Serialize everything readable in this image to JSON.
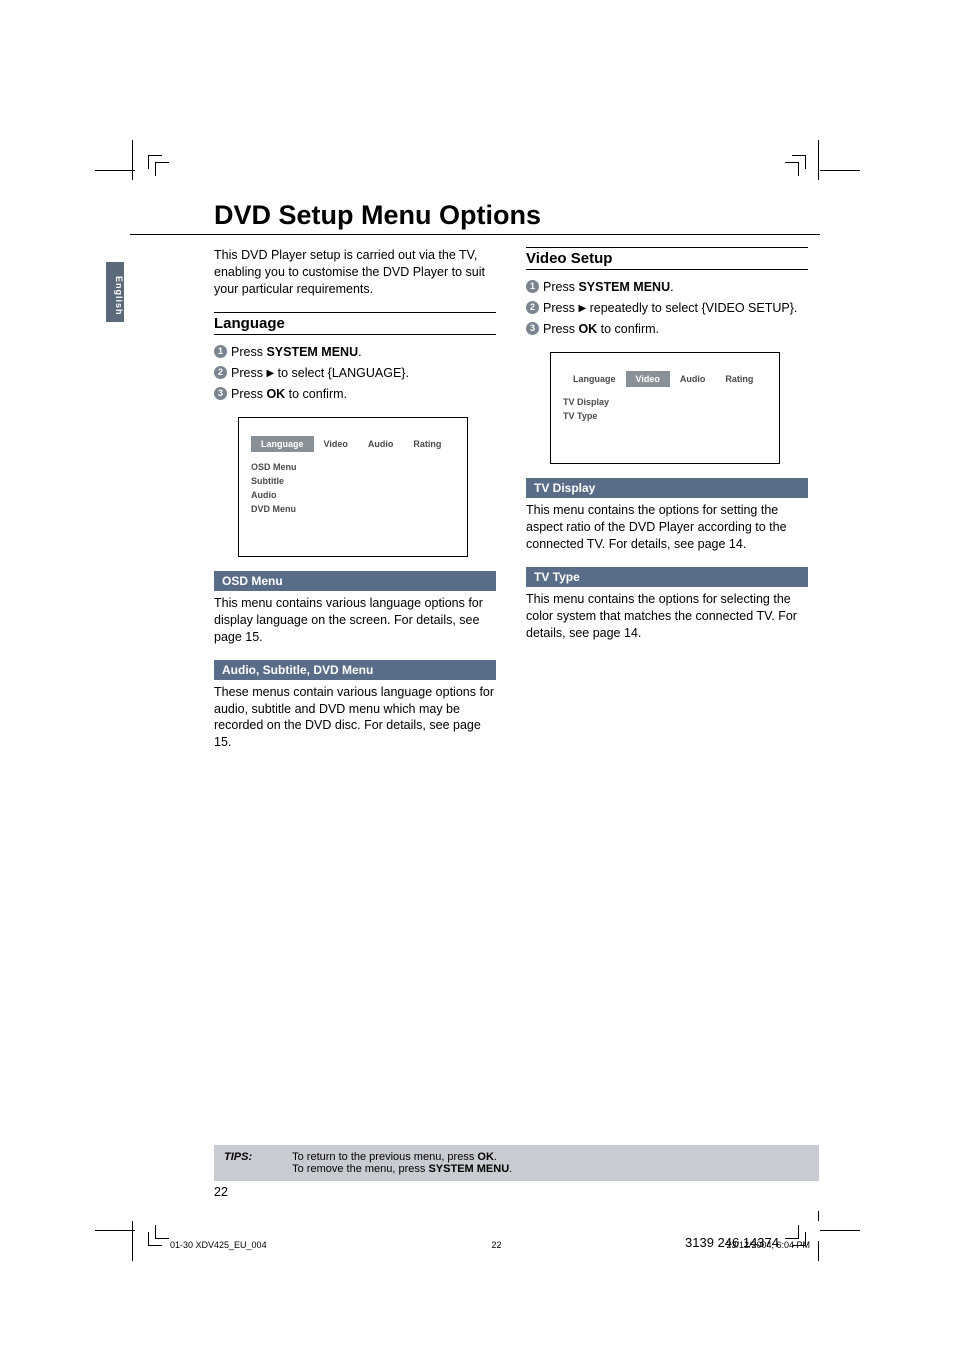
{
  "lang_tab": "English",
  "title": "DVD Setup Menu Options",
  "intro": "This DVD Player setup is carried out via the TV, enabling you to customise the DVD Player to suit your particular requirements.",
  "language": {
    "heading": "Language",
    "steps": [
      {
        "pre": "Press ",
        "bold": "SYSTEM MENU",
        "post": "."
      },
      {
        "pre": "Press ",
        "arrow": "▶",
        "post": " to select {LANGUAGE}."
      },
      {
        "pre": "Press ",
        "bold": "OK",
        "post": " to confirm."
      }
    ],
    "screen": {
      "tabs": [
        "Language",
        "Video",
        "Audio",
        "Rating"
      ],
      "active": 0,
      "items": [
        "OSD Menu",
        "Subtitle",
        "Audio",
        "DVD Menu"
      ]
    },
    "osd": {
      "heading": "OSD Menu",
      "body": "This menu contains various language options for display language on the screen. For details, see page 15."
    },
    "asdvd": {
      "heading": "Audio, Subtitle, DVD Menu",
      "body": "These menus contain various language options for audio, subtitle and DVD menu which may be recorded on the DVD disc. For details, see page 15."
    }
  },
  "video": {
    "heading": "Video Setup",
    "steps": [
      {
        "pre": "Press ",
        "bold": "SYSTEM MENU",
        "post": "."
      },
      {
        "pre": "Press ",
        "arrow": "▶",
        "post": " repeatedly to select {VIDEO SETUP}."
      },
      {
        "pre": "Press ",
        "bold": "OK",
        "post": " to confirm."
      }
    ],
    "screen": {
      "tabs": [
        "Language",
        "Video",
        "Audio",
        "Rating"
      ],
      "active": 1,
      "items": [
        "TV Display",
        "TV Type"
      ]
    },
    "tvdisplay": {
      "heading": "TV Display",
      "body": "This menu contains the options for setting the aspect ratio of the DVD Player according to the connected TV. For details, see page 14."
    },
    "tvtype": {
      "heading": "TV Type",
      "body": "This menu contains the options for selecting the color system that matches the connected TV. For details, see page 14."
    }
  },
  "tips": {
    "label": "TIPS:",
    "line1_pre": "To return to the previous menu, press ",
    "line1_bold": "OK",
    "line1_post": ".",
    "line2_pre": "To remove the menu, press ",
    "line2_bold": "SYSTEM MENU",
    "line2_post": "."
  },
  "page_number": "22",
  "footer": {
    "left": "01-30 XDV425_EU_004",
    "center": "22",
    "right": "23/12/2004, 6:04 PM",
    "sbn": "3139 246 14374"
  }
}
